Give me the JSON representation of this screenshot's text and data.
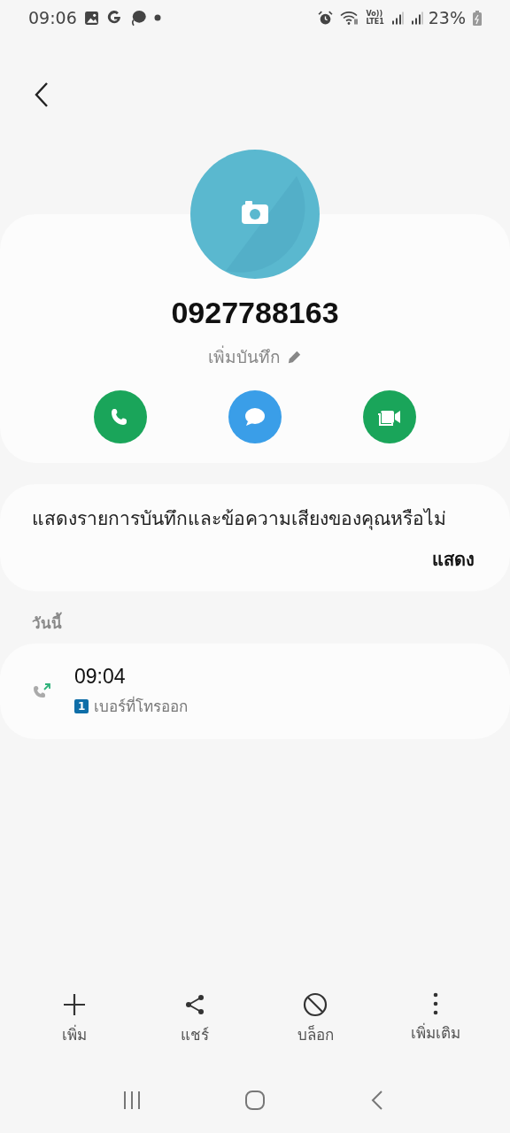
{
  "status_bar": {
    "time": "09:06",
    "volte": "Vo))",
    "network": "LTE1",
    "battery": "23%"
  },
  "contact": {
    "number": "0927788163",
    "note_label": "เพิ่มบันทึก",
    "actions": [
      {
        "kind": "call"
      },
      {
        "kind": "message"
      },
      {
        "kind": "video"
      }
    ]
  },
  "prompt": {
    "text": "แสดงรายการบันทึกและข้อความเสียงของคุณหรือไม่",
    "button": "แสดง"
  },
  "call_log": {
    "section": "วันนี้",
    "entries": [
      {
        "kind": "outgoing",
        "time": "09:04",
        "sim": "1",
        "type": "เบอร์ที่โทรออก"
      }
    ]
  },
  "toolbar": [
    {
      "kind": "add",
      "label": "เพิ่ม"
    },
    {
      "kind": "share",
      "label": "แชร์"
    },
    {
      "kind": "block",
      "label": "บล็อก"
    },
    {
      "kind": "more",
      "label": "เพิ่มเติม"
    }
  ]
}
